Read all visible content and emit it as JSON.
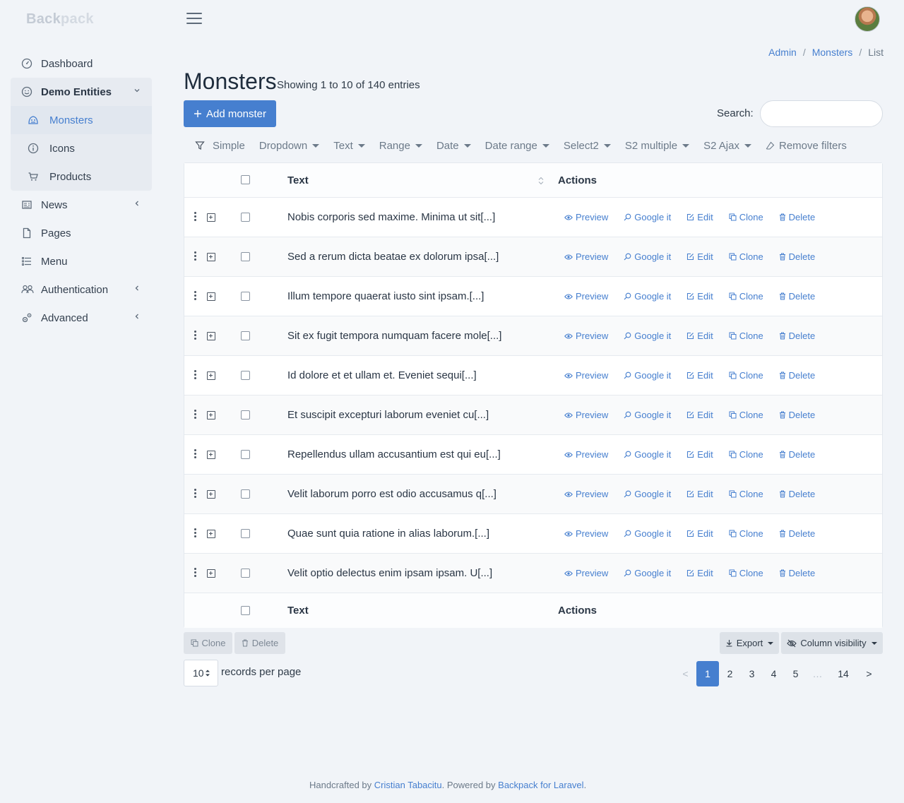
{
  "brand": {
    "part1": "Back",
    "part2": "pack"
  },
  "sidebar": {
    "items": [
      {
        "label": "Dashboard",
        "icon": "dashboard-icon"
      },
      {
        "label": "Demo Entities",
        "icon": "smile-icon"
      },
      {
        "label": "Monsters",
        "icon": "monster-icon"
      },
      {
        "label": "Icons",
        "icon": "info-icon"
      },
      {
        "label": "Products",
        "icon": "cart-icon"
      },
      {
        "label": "News",
        "icon": "newspaper-icon"
      },
      {
        "label": "Pages",
        "icon": "file-icon"
      },
      {
        "label": "Menu",
        "icon": "list-icon"
      },
      {
        "label": "Authentication",
        "icon": "users-icon"
      },
      {
        "label": "Advanced",
        "icon": "cogs-icon"
      }
    ]
  },
  "breadcrumb": {
    "admin": "Admin",
    "sep": "/",
    "monsters": "Monsters",
    "current": "List"
  },
  "page": {
    "title": "Monsters",
    "subtitle": "Showing 1 to 10 of 140 entries"
  },
  "toolbar": {
    "add_label": "Add monster",
    "search_label": "Search:",
    "search_value": ""
  },
  "filters": {
    "items": [
      "Simple",
      "Dropdown",
      "Text",
      "Range",
      "Date",
      "Date range",
      "Select2",
      "S2 multiple",
      "S2 Ajax"
    ],
    "remove": "Remove filters"
  },
  "table": {
    "columns": {
      "text": "Text",
      "actions": "Actions"
    },
    "row_actions": {
      "preview": "Preview",
      "google": "Google it",
      "edit": "Edit",
      "clone": "Clone",
      "delete": "Delete"
    },
    "rows": [
      "Nobis corporis sed maxime. Minima ut sit[...]",
      "Sed a rerum dicta beatae ex dolorum ipsa[...]",
      "Illum tempore quaerat iusto sint ipsam.[...]",
      "Sit ex fugit tempora numquam facere mole[...]",
      "Id dolore et et ullam et. Eveniet sequi[...]",
      "Et suscipit excepturi laborum eveniet cu[...]",
      "Repellendus ullam accusantium est qui eu[...]",
      "Velit laborum porro est odio accusamus q[...]",
      "Quae sunt quia ratione in alias laborum.[...]",
      "Velit optio delectus enim ipsam ipsam. U[...]"
    ]
  },
  "bulk": {
    "clone": "Clone",
    "delete": "Delete"
  },
  "export": {
    "export": "Export",
    "columns": "Column visibility"
  },
  "perpage": {
    "value": "10",
    "label": "records per page"
  },
  "pagination": {
    "prev": "<",
    "pages": [
      "1",
      "2",
      "3",
      "4",
      "5"
    ],
    "ellipsis": "…",
    "last": "14",
    "next": ">"
  },
  "footer": {
    "pre": "Handcrafted by ",
    "author": "Cristian Tabacitu",
    "mid": ". Powered by ",
    "powered": "Backpack for Laravel",
    "end": "."
  },
  "colors": {
    "primary": "#467fcf",
    "background": "#f1f4f8"
  }
}
